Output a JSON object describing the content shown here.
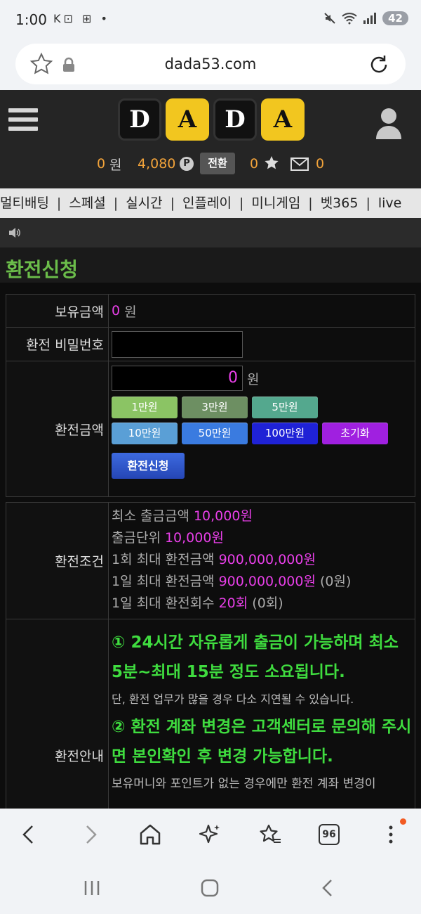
{
  "status": {
    "time": "1:00",
    "left_icons": "K⊡ ⊞ •",
    "battery": "42"
  },
  "browser": {
    "url": "dada53.com"
  },
  "header": {
    "logo_letters": [
      "D",
      "A",
      "D",
      "A"
    ],
    "money_value": "0",
    "money_unit": "원",
    "points_value": "4,080",
    "points_badge": "P",
    "convert_label": "전환",
    "star_count": "0",
    "mail_count": "0"
  },
  "nav": {
    "items": [
      "멀티배팅",
      "스페셜",
      "실시간",
      "인플레이",
      "미니게임",
      "벳365",
      "live"
    ],
    "separator": "|"
  },
  "page": {
    "title": "환전신청"
  },
  "form": {
    "balance_label": "보유금액",
    "balance_value": "0",
    "balance_unit": "원",
    "password_label": "환전 비밀번호",
    "amount_label": "환전금액",
    "amount_value": "0",
    "amount_unit": "원",
    "amount_buttons": [
      {
        "label": "1만원",
        "color": "#8bc464"
      },
      {
        "label": "3만원",
        "color": "#6d8f62"
      },
      {
        "label": "5만원",
        "color": "#54a88e"
      },
      {
        "label": "10만원",
        "color": "#5a9fd6"
      },
      {
        "label": "50만원",
        "color": "#3a7be0"
      },
      {
        "label": "100만원",
        "color": "#1f22d6"
      },
      {
        "label": "초기화",
        "color": "#a020e0"
      }
    ],
    "submit_label": "환전신청"
  },
  "conditions": {
    "label": "환전조건",
    "lines": [
      {
        "text": "최소 출금금액 ",
        "value": "10,000원",
        "suffix": ""
      },
      {
        "text": "출금단위 ",
        "value": "10,000원",
        "suffix": ""
      },
      {
        "text": "1회 최대 환전금액 ",
        "value": "900,000,000원",
        "suffix": ""
      },
      {
        "text": "1일 최대 환전금액 ",
        "value": "900,000,000원",
        "suffix": " (0원)"
      },
      {
        "text": "1일 최대 환전회수 ",
        "value": "20회",
        "suffix": " (0회)"
      }
    ]
  },
  "guide": {
    "label": "환전안내",
    "p1": "① 24시간 자유롭게 출금이 가능하며 최소 5분~최대 15분 정도 소요됩니다.",
    "p1_note": "단, 환전 업무가 많을 경우 다소 지연될 수 있습니다.",
    "p2": "② 환전 계좌 변경은 고객센터로 문의해 주시면 본인확인 후 변경 가능합니다.",
    "p2_note": "보유머니와 포인트가 없는 경우에만 환전 계좌 변경이"
  },
  "toolbar": {
    "tab_count": "96"
  },
  "colors": {
    "accent_green": "#6bbd4a",
    "accent_orange": "#f2a33a",
    "value_pink": "#e83fe8",
    "guide_green": "#3fdc3f"
  },
  "icons": [
    "star-icon",
    "lock-icon",
    "reload-icon",
    "menu-icon",
    "user-icon",
    "point-icon",
    "star-filled-icon",
    "mail-icon",
    "speaker-icon",
    "back-icon",
    "forward-icon",
    "home-icon",
    "sparkle-icon",
    "bookmarks-icon",
    "tabs-icon",
    "more-icon"
  ]
}
